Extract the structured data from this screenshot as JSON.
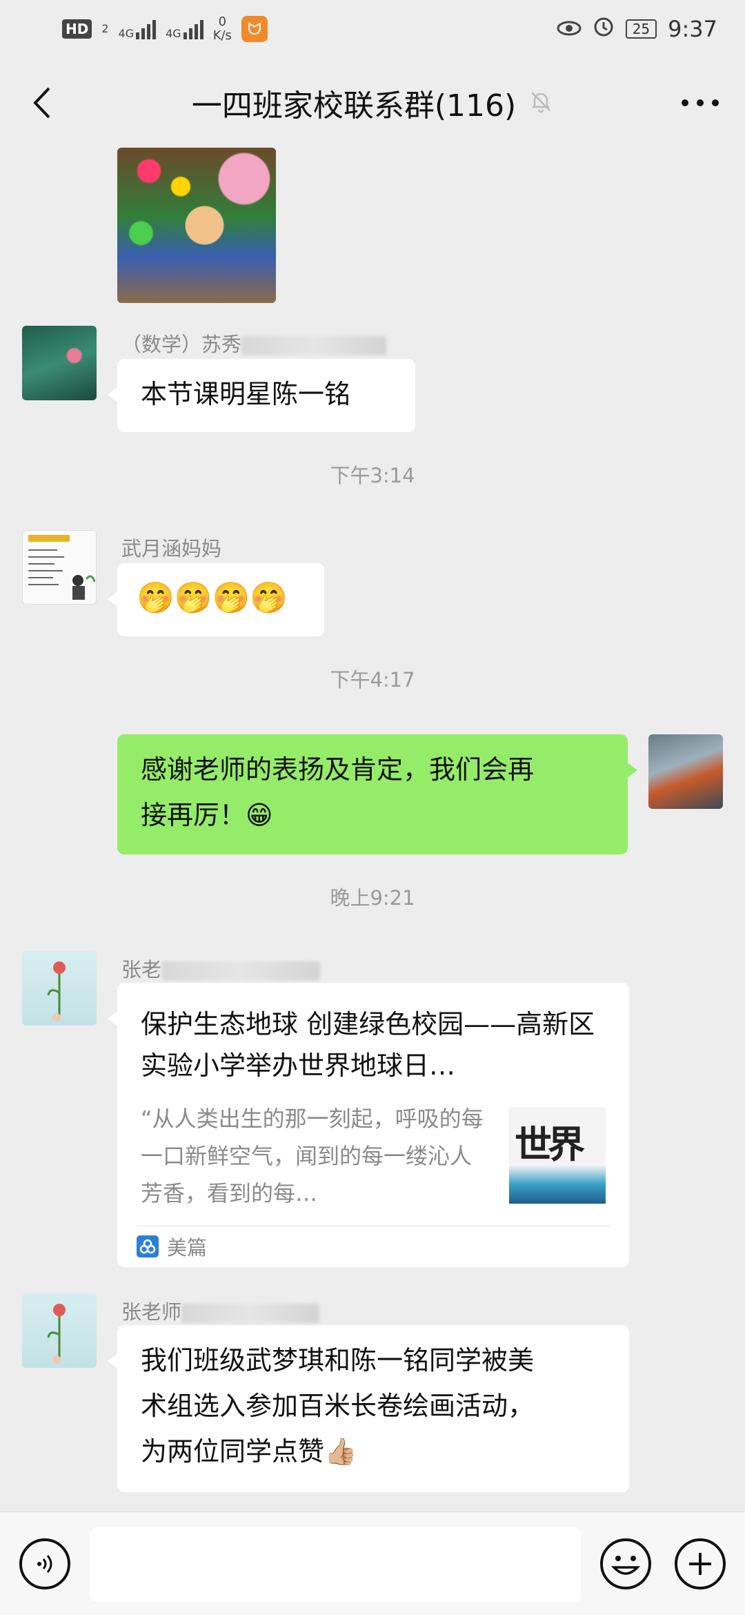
{
  "status_bar": {
    "hd_badge": "HD",
    "hd_sub": "2",
    "signal1_label": "4G",
    "signal2_label": "4G",
    "speed_value": "0",
    "speed_unit": "K/s",
    "battery": "25",
    "time": "9:37",
    "icons": [
      "eye-icon",
      "alarm-icon",
      "battery-icon"
    ]
  },
  "header": {
    "title": "一四班家校联系群(116)",
    "mute_icon": "bell-off-icon",
    "back_icon": "chevron-left-icon",
    "more_icon": "more-dots-icon"
  },
  "messages": [
    {
      "type": "image",
      "side": "left",
      "content": "photo"
    },
    {
      "type": "text",
      "side": "left",
      "sender": "（数学）苏秀",
      "text": "本节课明星陈一铭"
    },
    {
      "type": "time",
      "text": "下午3:14"
    },
    {
      "type": "text",
      "side": "left",
      "sender": "武月涵妈妈",
      "text": "🤭🤭🤭🤭"
    },
    {
      "type": "time",
      "text": "下午4:17"
    },
    {
      "type": "text",
      "side": "right",
      "text_line1": "感谢老师的表扬及肯定，我们会再",
      "text_line2": "接再厉！😁"
    },
    {
      "type": "time",
      "text": "晚上9:21"
    },
    {
      "type": "link",
      "side": "left",
      "sender": "张老",
      "title": "保护生态地球 创建绿色校园——高新区实验小学举办世界地球日…",
      "description": "“从人类出生的那一刻起，呼吸的每一口新鲜空气，闻到的每一缕沁人芳香，看到的每…",
      "thumb_text": "世界",
      "source": "美篇"
    },
    {
      "type": "text",
      "side": "left",
      "sender": "张老师",
      "text_line1": "我们班级武梦琪和陈一铭同学被美",
      "text_line2": "术组选入参加百米长卷绘画活动，",
      "text_line3": "为两位同学点赞👍🏼"
    }
  ],
  "input_bar": {
    "voice_icon": "voice-icon",
    "input_value": "",
    "emoji_icon": "emoji-icon",
    "plus_icon": "plus-icon"
  },
  "colors": {
    "background": "#ededed",
    "my_bubble": "#95ec69",
    "their_bubble": "#ffffff",
    "meta_text": "#8a8a8a"
  }
}
